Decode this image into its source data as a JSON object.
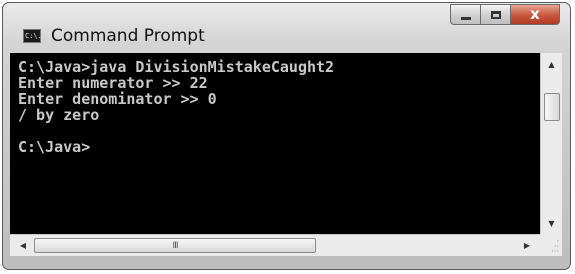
{
  "window": {
    "title": "Command Prompt",
    "icon": "command-prompt-icon",
    "icon_text": "C:\\."
  },
  "controls": {
    "minimize_icon": "minimize-icon",
    "maximize_icon": "maximize-icon",
    "close_glyph": "x"
  },
  "console": {
    "lines": [
      "C:\\Java>java DivisionMistakeCaught2",
      "Enter numerator >> 22",
      "Enter denominator >> 0",
      "/ by zero",
      "",
      "C:\\Java>"
    ],
    "background": "#000000",
    "text_color": "#c8c8c8"
  },
  "scrollbars": {
    "up_arrow": "▲",
    "down_arrow": "▼",
    "left_arrow": "◀",
    "right_arrow": "▶",
    "thumb_grip": "III"
  },
  "colors": {
    "close_button": "#c8553d",
    "chrome": "#d4d4d4"
  }
}
